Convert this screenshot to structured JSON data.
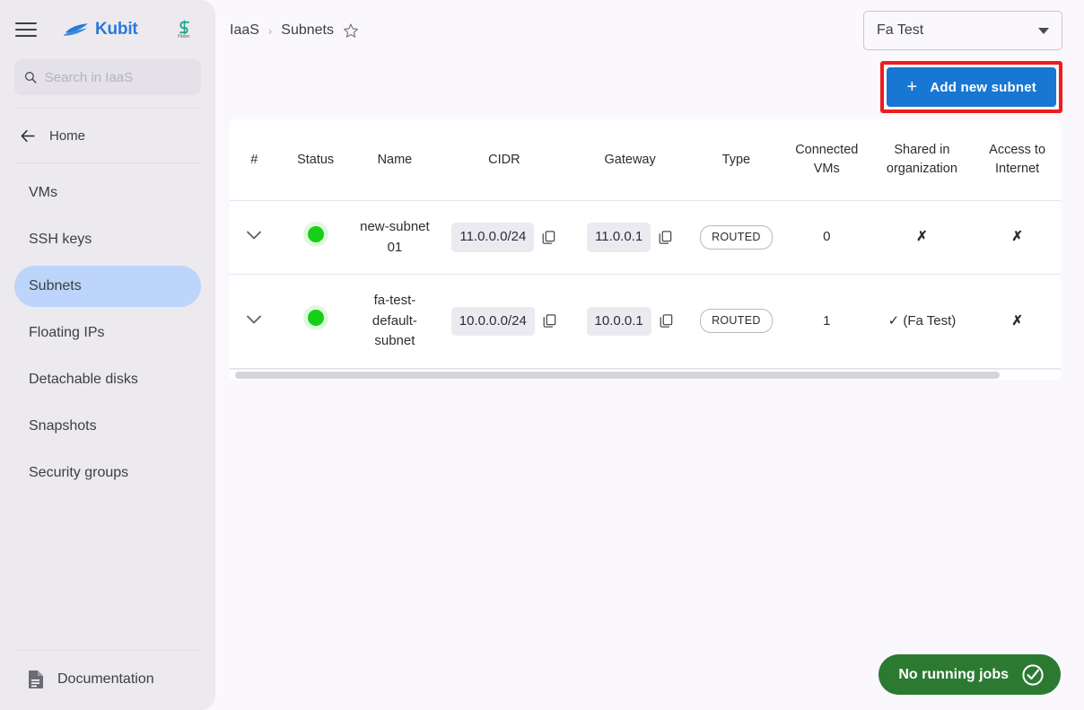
{
  "sidebar": {
    "menu_icon": "hamburger-icon",
    "brand": {
      "name": "Kubit",
      "mark": "boat-logo-icon"
    },
    "partner": {
      "mark": "s-logo-icon",
      "caption": "Pikoinn"
    },
    "search": {
      "value": "",
      "placeholder": "Search in IaaS",
      "icon": "search-icon"
    },
    "home": {
      "label": "Home",
      "icon": "arrow-left-icon"
    },
    "items": [
      {
        "label": "VMs",
        "active": false
      },
      {
        "label": "SSH keys",
        "active": false
      },
      {
        "label": "Subnets",
        "active": true
      },
      {
        "label": "Floating IPs",
        "active": false
      },
      {
        "label": "Detachable disks",
        "active": false
      },
      {
        "label": "Snapshots",
        "active": false
      },
      {
        "label": "Security groups",
        "active": false
      }
    ],
    "documentation": {
      "label": "Documentation",
      "icon": "document-icon"
    }
  },
  "topbar": {
    "breadcrumb": {
      "root": "IaaS",
      "separator": "›",
      "current": "Subnets",
      "star_icon": "star-outline-icon"
    },
    "org_select": {
      "value": "Fa Test",
      "caret_icon": "chevron-down-icon"
    }
  },
  "actions": {
    "add_subnet": {
      "label": "Add new subnet",
      "icon": "plus-icon",
      "highlight_color": "#ee1c1c",
      "bg_color": "#1877d2"
    }
  },
  "table": {
    "headers": {
      "index": "#",
      "status": "Status",
      "name": "Name",
      "cidr": "CIDR",
      "gateway": "Gateway",
      "type": "Type",
      "connected_vms": "Connected VMs",
      "shared": "Shared in organization",
      "internet": "Access to Internet"
    },
    "rows": [
      {
        "expand_icon": "chevron-down-icon",
        "status": "active",
        "status_color": "#16cf16",
        "name": "new-subnet 01",
        "cidr": "11.0.0.0/24",
        "cidr_copy_icon": "copy-icon",
        "gateway": "11.0.0.1",
        "gateway_copy_icon": "copy-icon",
        "type": "ROUTED",
        "connected_vms": "0",
        "shared": "✗",
        "internet": "✗"
      },
      {
        "expand_icon": "chevron-down-icon",
        "status": "active",
        "status_color": "#16cf16",
        "name": "fa-test-default-subnet",
        "cidr": "10.0.0.0/24",
        "cidr_copy_icon": "copy-icon",
        "gateway": "10.0.0.1",
        "gateway_copy_icon": "copy-icon",
        "type": "ROUTED",
        "connected_vms": "1",
        "shared": "✓ (Fa Test)",
        "internet": "✗"
      }
    ]
  },
  "jobs_status": {
    "label": "No running jobs",
    "icon": "check-circle-icon",
    "color": "#2c7a32"
  }
}
